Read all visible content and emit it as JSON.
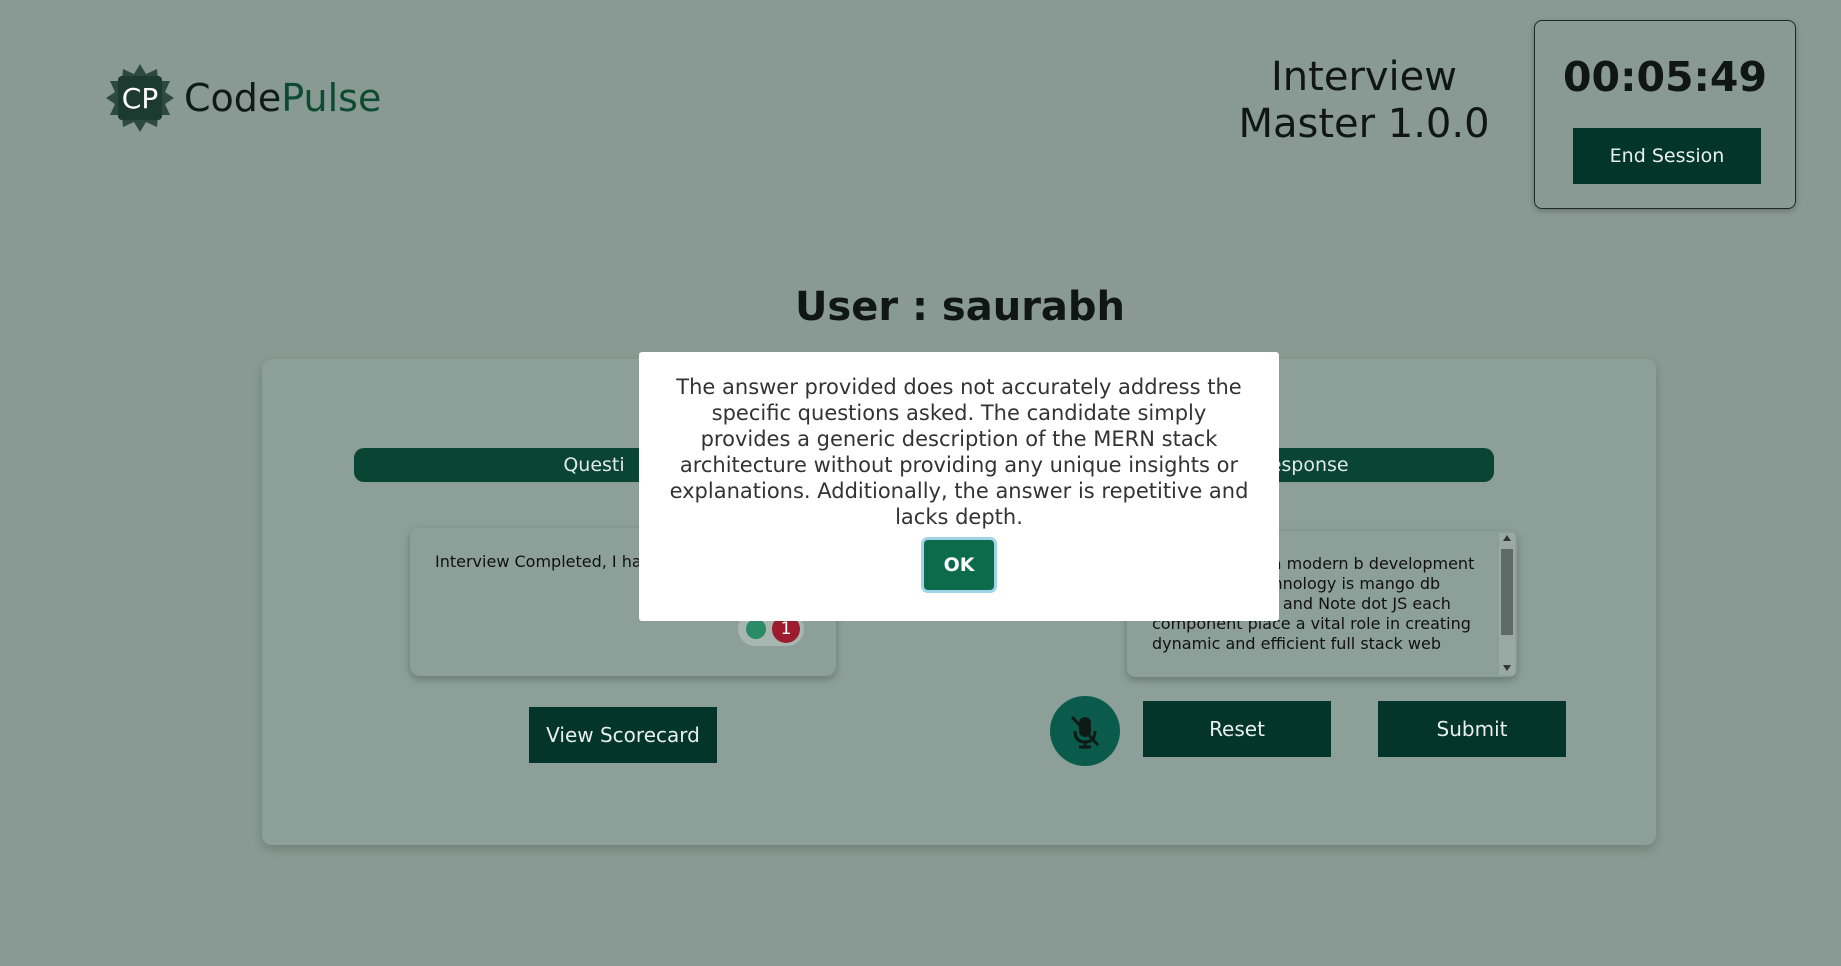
{
  "header": {
    "logo_initials": "CP",
    "logo_name_primary": "Code",
    "logo_name_accent": "Pulse",
    "app_title": "Interview Master 1.0.0",
    "timer": "00:05:49",
    "end_session_label": "End Session"
  },
  "user_label": "User : saurabh",
  "panel": {
    "question_header": "Questi",
    "response_header": "Response",
    "question_text": "Interview Completed, I hav Feedback",
    "badge_count": "1",
    "response_text": "architecture is a modern b development approach K technology is mango db express.js react and Note dot JS each component place a vital role in creating dynamic and efficient full stack web",
    "view_scorecard_label": "View Scorecard",
    "reset_label": "Reset",
    "submit_label": "Submit"
  },
  "modal": {
    "message": "The answer provided does not accurately address the specific questions asked. The candidate simply provides a generic description of the MERN stack architecture without providing any unique insights or explanations. Additionally, the answer is repetitive and lacks depth.",
    "ok_label": "OK"
  },
  "icons": {
    "mic": "mic-off-icon",
    "logo": "logo-badge-icon"
  },
  "colors": {
    "accent": "#04352a",
    "brand": "#0c4a32",
    "ok": "#0c6b4a"
  }
}
